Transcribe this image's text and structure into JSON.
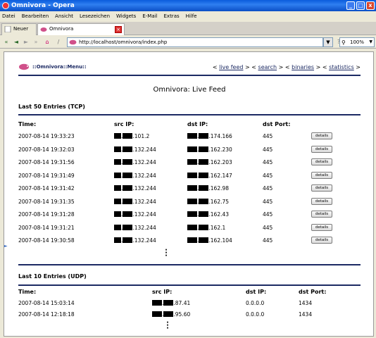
{
  "window": {
    "title": "Omnivora - Opera",
    "buttons": [
      "_",
      "□",
      "x"
    ]
  },
  "menubar": [
    "Datei",
    "Bearbeiten",
    "Ansicht",
    "Lesezeichen",
    "Widgets",
    "E-Mail",
    "Extras",
    "Hilfe"
  ],
  "tabs": [
    {
      "label": "Neuer Tab",
      "active": false
    },
    {
      "label": "Omnivora",
      "active": true
    }
  ],
  "address": {
    "url": "http://localhost/omnivora/index.php",
    "zoom": "100%"
  },
  "page": {
    "menu_title": "::Omnivora::Menu::",
    "breadcrumbs": {
      "sep_open": "<",
      "sep_close": ">",
      "links": [
        "live feed",
        "search",
        "binaries",
        "statistics"
      ]
    },
    "title": "Omnivora: Live Feed",
    "tcp": {
      "heading": "Last 50 Entries (TCP)",
      "columns": [
        "Time:",
        "src IP:",
        "dst IP:",
        "dst Port:"
      ],
      "button_label": "details",
      "rows": [
        {
          "time": "2007-08-14 19:33:23",
          "src": ".101.2",
          "dst": ".174.166",
          "port": "445"
        },
        {
          "time": "2007-08-14 19:32:03",
          "src": ".132.244",
          "dst": ".162.230",
          "port": "445"
        },
        {
          "time": "2007-08-14 19:31:56",
          "src": ".132.244",
          "dst": ".162.203",
          "port": "445"
        },
        {
          "time": "2007-08-14 19:31:49",
          "src": ".132.244",
          "dst": ".162.147",
          "port": "445"
        },
        {
          "time": "2007-08-14 19:31:42",
          "src": ".132.244",
          "dst": ".162.98",
          "port": "445"
        },
        {
          "time": "2007-08-14 19:31:35",
          "src": ".132.244",
          "dst": ".162.75",
          "port": "445"
        },
        {
          "time": "2007-08-14 19:31:28",
          "src": ".132.244",
          "dst": ".162.43",
          "port": "445"
        },
        {
          "time": "2007-08-14 19:31:21",
          "src": ".132.244",
          "dst": ".162.1",
          "port": "445"
        },
        {
          "time": "2007-08-14 19:30:58",
          "src": ".132.244",
          "dst": ".162.104",
          "port": "445"
        }
      ]
    },
    "udp": {
      "heading": "Last 10 Entries (UDP)",
      "columns": [
        "Time:",
        "src IP:",
        "dst IP:",
        "dst Port:"
      ],
      "rows": [
        {
          "time": "2007-08-14 15:03:14",
          "src": ".87.41",
          "dst": "0.0.0.0",
          "port": "1434"
        },
        {
          "time": "2007-08-14 12:18:18",
          "src": ".95.60",
          "dst": "0.0.0.0",
          "port": "1434"
        }
      ]
    }
  },
  "colors": {
    "rule": "#1c2a63",
    "titlebar": "#0a5bdc"
  }
}
